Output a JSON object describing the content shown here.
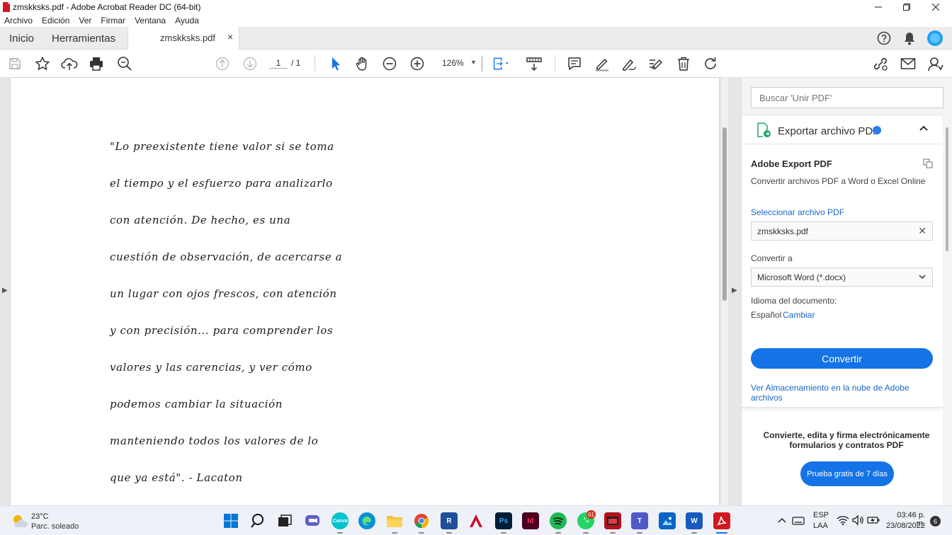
{
  "window": {
    "title": "zmskksks.pdf - Adobe Acrobat Reader DC (64-bit)"
  },
  "menu": [
    "Archivo",
    "Edición",
    "Ver",
    "Firmar",
    "Ventana",
    "Ayuda"
  ],
  "tabs": {
    "home": "Inicio",
    "tools": "Herramientas",
    "document": "zmskksks.pdf",
    "close": "×"
  },
  "toolbar": {
    "page_current": "1",
    "page_total": "/ 1",
    "zoom": "126%"
  },
  "document": {
    "lines": [
      "\"Lo preexistente tiene valor si se toma",
      "el tiempo y el esfuerzo para analizarlo",
      "con atención. De hecho, es una",
      "cuestión de observación, de acercarse a",
      "un lugar con ojos frescos, con atención",
      "y con precisión... para comprender los",
      "valores y las carencias, y ver cómo",
      "podemos cambiar la situación",
      "manteniendo todos los valores de lo",
      "que ya está\". - Lacaton"
    ]
  },
  "right_pane": {
    "search_placeholder": "Buscar 'Unir PDF'",
    "export_header": "Exportar archivo PDF",
    "export_title": "Adobe Export PDF",
    "export_desc": "Convertir archivos PDF a Word o Excel Online",
    "select_file": "Seleccionar archivo PDF",
    "file_name": "zmskksks.pdf",
    "convert_to": "Convertir a",
    "format": "Microsoft Word (*.docx)",
    "lang_label": "Idioma del documento:",
    "lang_value": "Español",
    "lang_change": "Cambiar",
    "convert_btn": "Convertir",
    "cloud_link": "Ver Almacenamiento en la nube de Adobe archivos",
    "promo_text": "Convierte, edita y firma electrónicamente formularios y contratos PDF",
    "trial_btn": "Prueba gratis de 7 días"
  },
  "taskbar": {
    "temperature": "23°C",
    "weather": "Parc. soleado",
    "lang1": "ESP",
    "lang2": "LAA",
    "time": "03:46 p. m.",
    "date": "23/08/2022",
    "notifications": "6",
    "whatsapp_badge": "61",
    "apps": [
      "windows-start",
      "search",
      "task-view",
      "teams-chat",
      "canva",
      "edge",
      "file-explorer",
      "chrome",
      "revit",
      "autocad",
      "photoshop",
      "indesign",
      "spotify",
      "whatsapp",
      "calendar-app",
      "teams",
      "photos",
      "word",
      "acrobat"
    ],
    "colors": {
      "canva": "#00c4cc",
      "edge": "#0c8fd8",
      "chrome": "#db4437",
      "revit": "#1f4e9a",
      "autocad": "#c8102e",
      "photoshop": "#001e36",
      "indesign": "#49021f",
      "spotify": "#1db954",
      "whatsapp": "#25d366",
      "teams": "#5059c9",
      "word": "#185abd",
      "acrobat": "#d0191f"
    }
  }
}
